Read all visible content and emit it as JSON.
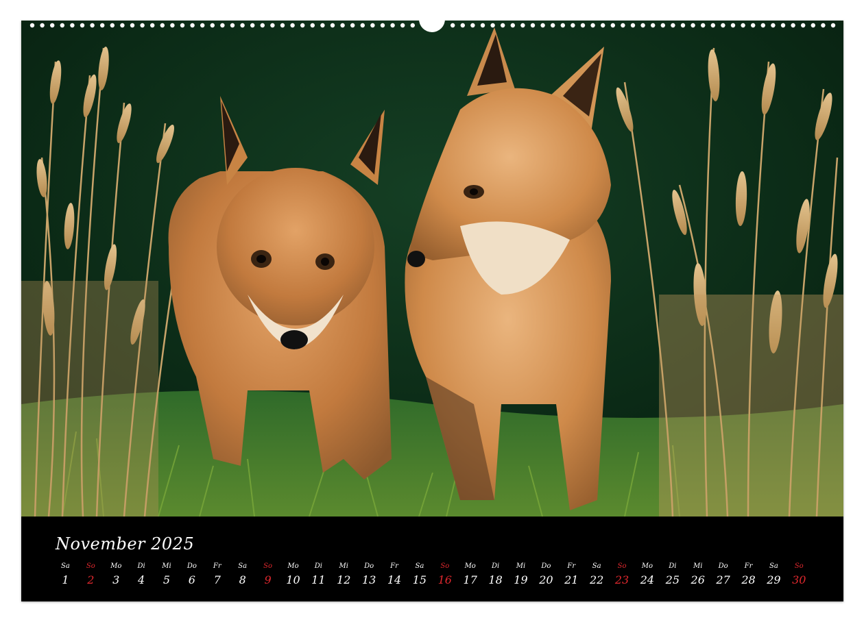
{
  "calendar": {
    "month_title": "November 2025",
    "sunday_color": "#e0282e",
    "days": [
      {
        "wd": "Sa",
        "dn": "1",
        "sunday": false
      },
      {
        "wd": "So",
        "dn": "2",
        "sunday": true
      },
      {
        "wd": "Mo",
        "dn": "3",
        "sunday": false
      },
      {
        "wd": "Di",
        "dn": "4",
        "sunday": false
      },
      {
        "wd": "Mi",
        "dn": "5",
        "sunday": false
      },
      {
        "wd": "Do",
        "dn": "6",
        "sunday": false
      },
      {
        "wd": "Fr",
        "dn": "7",
        "sunday": false
      },
      {
        "wd": "Sa",
        "dn": "8",
        "sunday": false
      },
      {
        "wd": "So",
        "dn": "9",
        "sunday": true
      },
      {
        "wd": "Mo",
        "dn": "10",
        "sunday": false
      },
      {
        "wd": "Di",
        "dn": "11",
        "sunday": false
      },
      {
        "wd": "Mi",
        "dn": "12",
        "sunday": false
      },
      {
        "wd": "Do",
        "dn": "13",
        "sunday": false
      },
      {
        "wd": "Fr",
        "dn": "14",
        "sunday": false
      },
      {
        "wd": "Sa",
        "dn": "15",
        "sunday": false
      },
      {
        "wd": "So",
        "dn": "16",
        "sunday": true
      },
      {
        "wd": "Mo",
        "dn": "17",
        "sunday": false
      },
      {
        "wd": "Di",
        "dn": "18",
        "sunday": false
      },
      {
        "wd": "Mi",
        "dn": "19",
        "sunday": false
      },
      {
        "wd": "Do",
        "dn": "20",
        "sunday": false
      },
      {
        "wd": "Fr",
        "dn": "21",
        "sunday": false
      },
      {
        "wd": "Sa",
        "dn": "22",
        "sunday": false
      },
      {
        "wd": "So",
        "dn": "23",
        "sunday": true
      },
      {
        "wd": "Mo",
        "dn": "24",
        "sunday": false
      },
      {
        "wd": "Di",
        "dn": "25",
        "sunday": false
      },
      {
        "wd": "Mi",
        "dn": "26",
        "sunday": false
      },
      {
        "wd": "Do",
        "dn": "27",
        "sunday": false
      },
      {
        "wd": "Fr",
        "dn": "28",
        "sunday": false
      },
      {
        "wd": "Sa",
        "dn": "29",
        "sunday": false
      },
      {
        "wd": "So",
        "dn": "30",
        "sunday": true
      }
    ]
  }
}
